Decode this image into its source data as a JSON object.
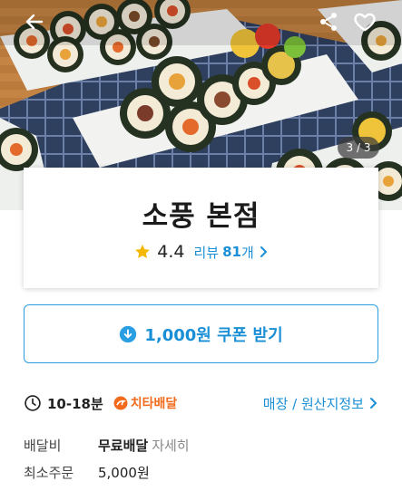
{
  "hero": {
    "image_counter": "3 / 3",
    "icons": [
      "back-arrow-icon",
      "share-icon",
      "heart-icon"
    ]
  },
  "store": {
    "name": "소풍 본점",
    "rating": "4.4",
    "review_label": "리뷰",
    "review_count": "81",
    "review_unit": "개"
  },
  "coupon": {
    "label": "1,000원 쿠폰 받기"
  },
  "delivery": {
    "time": "10-18분",
    "badge_label": "치타배달",
    "store_info_link": "매장 / 원산지정보"
  },
  "fees": {
    "delivery_fee_label": "배달비",
    "delivery_fee_value": "무료배달",
    "delivery_fee_detail": "자세히",
    "min_order_label": "최소주문",
    "min_order_value": "5,000원"
  },
  "colors": {
    "accent_blue": "#1a8fd6",
    "cheetah_orange": "#f26a1b",
    "star_yellow": "#f5b800"
  }
}
